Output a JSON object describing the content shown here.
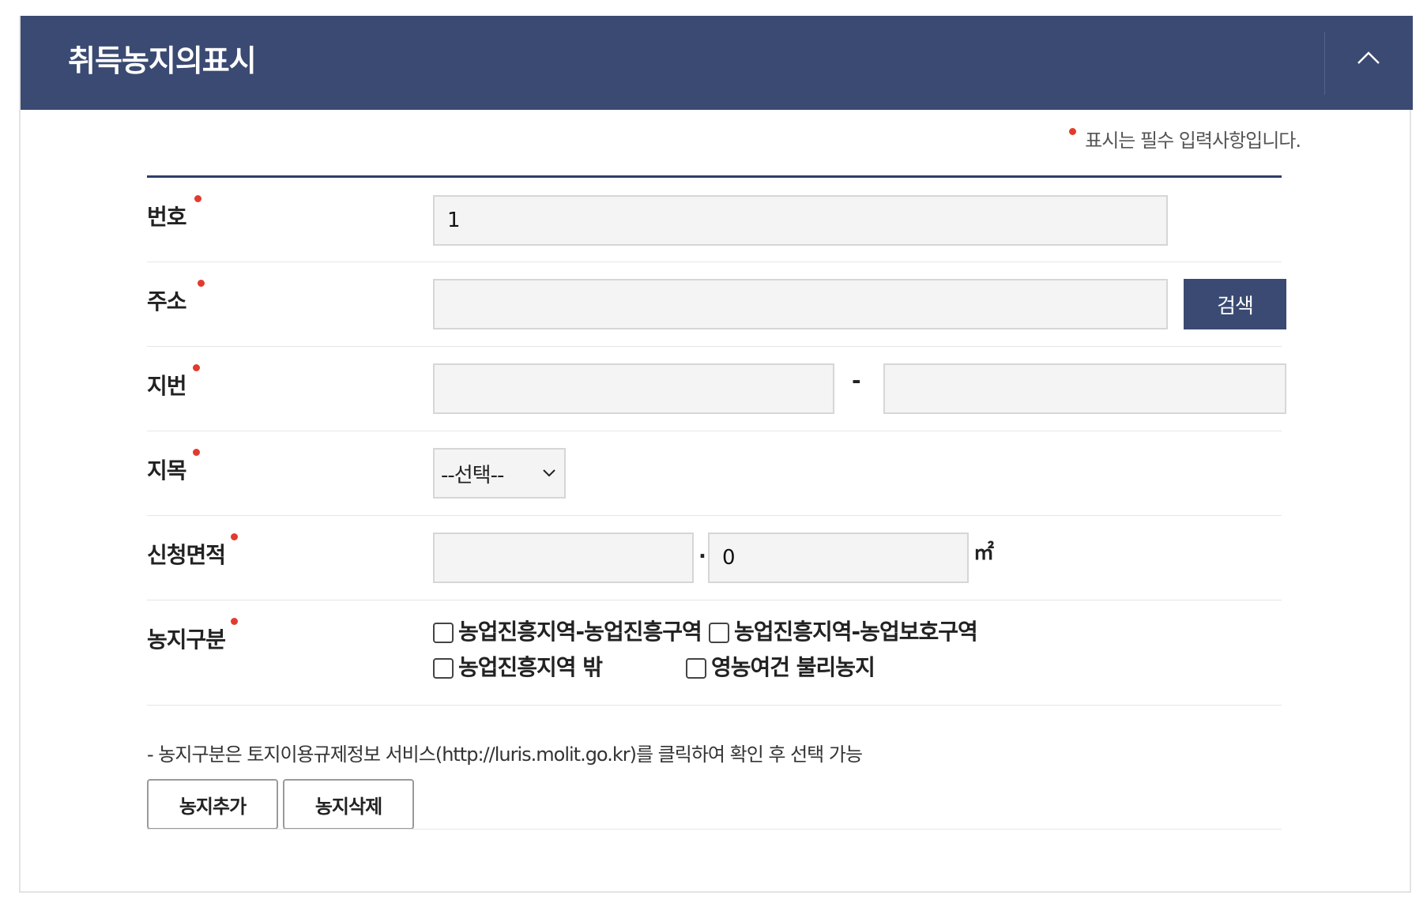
{
  "panel": {
    "title": "취득농지의표시",
    "collapse_icon": "chevron-up-icon"
  },
  "required_note": "표시는 필수 입력사항입니다.",
  "colors": {
    "header_bg": "#3a4a72",
    "required_dot": "#e23b2e",
    "primary_button": "#3a4a72",
    "input_bg": "#f4f4f4"
  },
  "form": {
    "number": {
      "label": "번호",
      "value": "1"
    },
    "address": {
      "label": "주소",
      "value": "",
      "search_label": "검색"
    },
    "lot": {
      "label": "지번",
      "main_value": "",
      "separator": "-",
      "sub_value": ""
    },
    "land_category": {
      "label": "지목",
      "selected": "--선택--"
    },
    "area": {
      "label": "신청면적",
      "int_value": "",
      "separator": ".",
      "dec_value": "0",
      "unit": "㎡"
    },
    "farmland_type": {
      "label": "농지구분",
      "options": [
        {
          "label": "농업진흥지역-농업진흥구역",
          "checked": false
        },
        {
          "label": "농업진흥지역-농업보호구역",
          "checked": false
        },
        {
          "label": "농업진흥지역 밖",
          "checked": false
        },
        {
          "label": "영농여건 불리농지",
          "checked": false
        }
      ]
    }
  },
  "help_text": "- 농지구분은 토지이용규제정보 서비스(http://luris.molit.go.kr)를 클릭하여 확인 후 선택 가능",
  "actions": {
    "add_label": "농지추가",
    "delete_label": "농지삭제"
  }
}
